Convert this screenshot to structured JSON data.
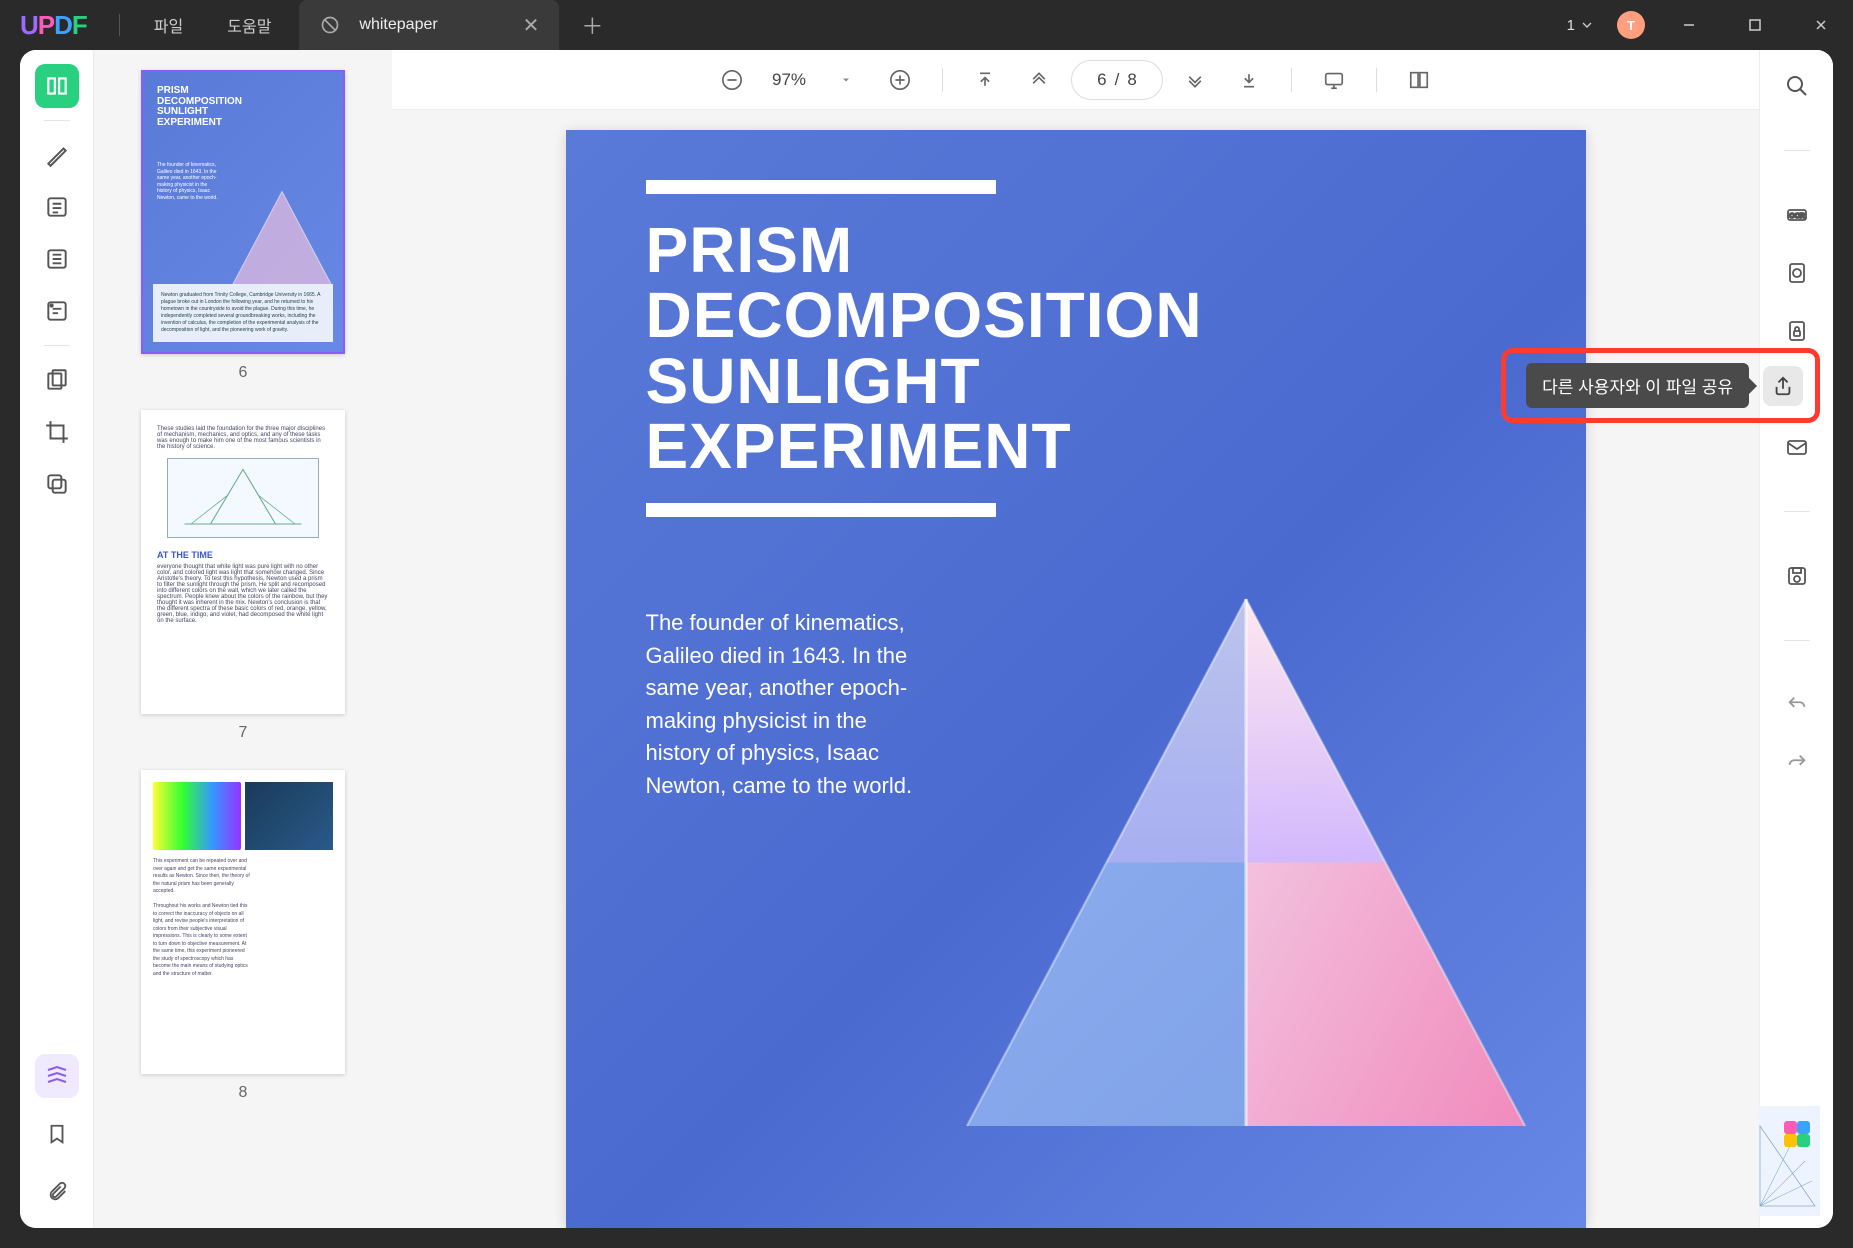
{
  "logo": "UPDF",
  "menu": {
    "file": "파일",
    "help": "도움말"
  },
  "tab": {
    "title": "whitepaper"
  },
  "titlebar": {
    "doc_count": "1",
    "avatar_initial": "T"
  },
  "toolbar": {
    "zoom": "97%",
    "page_current": "6",
    "page_sep": "/",
    "page_total": "8"
  },
  "document": {
    "title_line1": "PRISM",
    "title_line2": "DECOMPOSITION",
    "title_line3": "SUNLIGHT",
    "title_line4": "EXPERIMENT",
    "body": "The founder of kinematics, Galileo died in 1643. In the same year, another epoch-making physicist in the history of physics, Isaac Newton, came to the world."
  },
  "thumbnails": {
    "page6": {
      "num": "6",
      "title": "PRISM\nDECOMPOSITION\nSUNLIGHT\nEXPERIMENT"
    },
    "page7": {
      "num": "7",
      "headline": "AT THE TIME"
    },
    "page8": {
      "num": "8"
    }
  },
  "tooltip": {
    "share": "다른 사용자와 이 파일 공유"
  }
}
